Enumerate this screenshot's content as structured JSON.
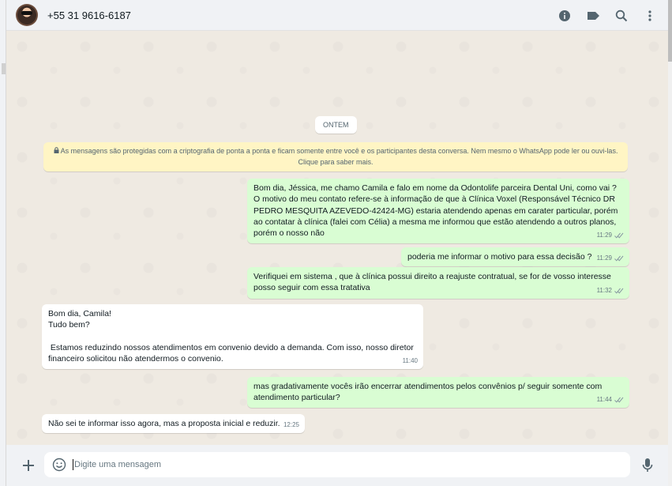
{
  "header": {
    "contact_name": "+55 31 9616-6187",
    "icons": [
      "info-icon",
      "label-icon",
      "search-icon",
      "menu-icon"
    ]
  },
  "chat": {
    "date_chip": "ONTEM",
    "encryption_notice": "As mensagens são protegidas com a criptografia de ponta a ponta e ficam somente entre você e os participantes desta conversa. Nem mesmo o WhatsApp pode ler ou ouvi-las. Clique para saber mais.",
    "messages": [
      {
        "direction": "out",
        "text": "Bom dia, Jéssica, me chamo Camila e falo em nome da Odontolife parceira Dental Uni, como vai ? O motivo do meu contato refere-se à informação de que à Clínica Voxel (Responsável Técnico DR PEDRO MESQUITA AZEVEDO-42424-MG) estaria atendendo apenas em carater particular, porém ao contatar à clínica (falei com Célia) a mesma me informou que estão atendendo a outros planos, porém o nosso não",
        "time": "11:29",
        "read": true
      },
      {
        "direction": "out",
        "text": "poderia me informar o motivo para essa decisão ?",
        "time": "11:29",
        "read": true
      },
      {
        "direction": "out",
        "text": "Verifiquei em sistema , que à clínica possui direito a reajuste contratual, se for de vosso interesse posso seguir com essa tratativa",
        "time": "11:32",
        "read": true
      },
      {
        "direction": "in",
        "text": "Bom dia, Camila!\nTudo bem?\n\n Estamos reduzindo nossos atendimentos em convenio devido a demanda. Com isso, nosso diretor financeiro solicitou não atendermos o convenio.",
        "time": "11:40",
        "read": false
      },
      {
        "direction": "out",
        "text": "mas gradativamente vocês irão encerrar atendimentos pelos convênios p/ seguir somente com atendimento particular?",
        "time": "11:44",
        "read": true
      },
      {
        "direction": "in",
        "text": "Não sei te informar isso agora, mas a proposta inicial e reduzir.",
        "time": "12:25",
        "read": false
      }
    ]
  },
  "footer": {
    "placeholder": "Digite uma mensagem",
    "value": ""
  },
  "colors": {
    "outgoing_bubble": "#d9fdd3",
    "incoming_bubble": "#ffffff",
    "chat_background": "#efeae2",
    "read_ticks": "#53bdeb",
    "notice_background": "#fff5c4"
  }
}
